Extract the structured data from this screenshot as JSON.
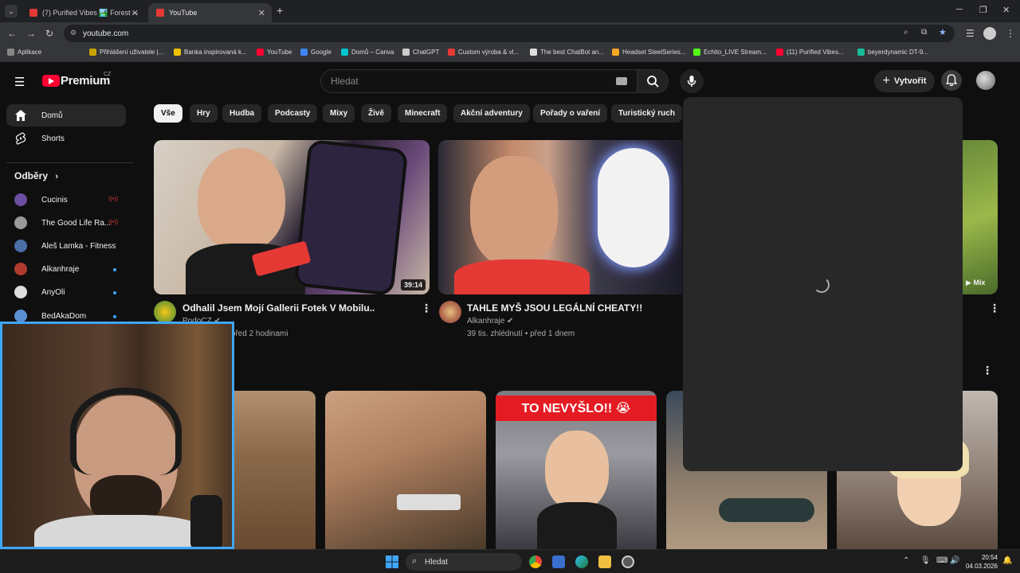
{
  "browser": {
    "tabs": [
      {
        "title": "(7) Purified Vibes 🏞️ Forest —",
        "active": false
      },
      {
        "title": "YouTube",
        "active": true
      }
    ],
    "new_tab_label": "+",
    "url": "youtube.com",
    "bookmarks": [
      {
        "label": "Aplikace",
        "color": "#888"
      },
      {
        "label": "Přihlášení uživatele |...",
        "color": "#c9a400"
      },
      {
        "label": "Banka inspirovaná k...",
        "color": "#f0c000"
      },
      {
        "label": "YouTube",
        "color": "#ff0033"
      },
      {
        "label": "Google",
        "color": "#4285f4"
      },
      {
        "label": "Domů – Canva",
        "color": "#00c4cc"
      },
      {
        "label": "ChatGPT",
        "color": "#cccccc"
      },
      {
        "label": "Custom výroba & vl...",
        "color": "#e53935"
      },
      {
        "label": "The best ChatBot an...",
        "color": "#dddddd"
      },
      {
        "label": "Headset SteelSeries...",
        "color": "#f5a623"
      },
      {
        "label": "Echito_LIVE Stream...",
        "color": "#53fc18"
      },
      {
        "label": "(11) Purified Vibes...",
        "color": "#ff0033"
      },
      {
        "label": "beyerdynamic DT-9...",
        "color": "#1abc9c"
      }
    ]
  },
  "youtube": {
    "logo_text": "Premium",
    "country": "CZ",
    "search_placeholder": "Hledat",
    "create_label": "Vytvořit",
    "sidebar": {
      "items": [
        {
          "label": "Domů",
          "icon": "home-icon",
          "active": true
        },
        {
          "label": "Shorts",
          "icon": "shorts-icon",
          "active": false
        }
      ],
      "subscriptions_title": "Odběry",
      "subscriptions": [
        {
          "name": "Cucinis",
          "status": "live",
          "color": "#6b4fa0"
        },
        {
          "name": "The Good Life Ra...",
          "status": "live",
          "color": "#999999"
        },
        {
          "name": "Aleš Lamka - Fitness",
          "status": "none",
          "color": "#4a6fa5"
        },
        {
          "name": "Alkanhraje",
          "status": "dot",
          "color": "#b03a2e"
        },
        {
          "name": "AnyOli",
          "status": "dot",
          "color": "#dddddd"
        },
        {
          "name": "BedAkaDom",
          "status": "dot",
          "color": "#5a8fd0"
        }
      ]
    },
    "chips": [
      "Vše",
      "Hry",
      "Hudba",
      "Podcasty",
      "Mixy",
      "Živě",
      "Minecraft",
      "Akční adventury",
      "Pořady o vaření",
      "Turistický ruch"
    ],
    "videos": [
      {
        "title": "Odhalil Jsem Mojí Gallerii Fotek V Mobilu..",
        "channel": "PodoCZ",
        "meta": "... zhlédnutí • před 2 hodinami",
        "duration": "39:14"
      },
      {
        "title": "TAHLE MYŠ JSOU LEGÁLNÍ CHEATY!!",
        "channel": "Alkanhraje",
        "meta": "39 tis. zhlédnutí • před 1 dnem",
        "duration": ""
      }
    ],
    "mix_label": "Mix",
    "shorts_overlay_text": "TO NEVYŠLO!! 😭"
  },
  "taskbar": {
    "search_label": "Hledat",
    "time": "20:54",
    "date": "04.03.2026"
  }
}
